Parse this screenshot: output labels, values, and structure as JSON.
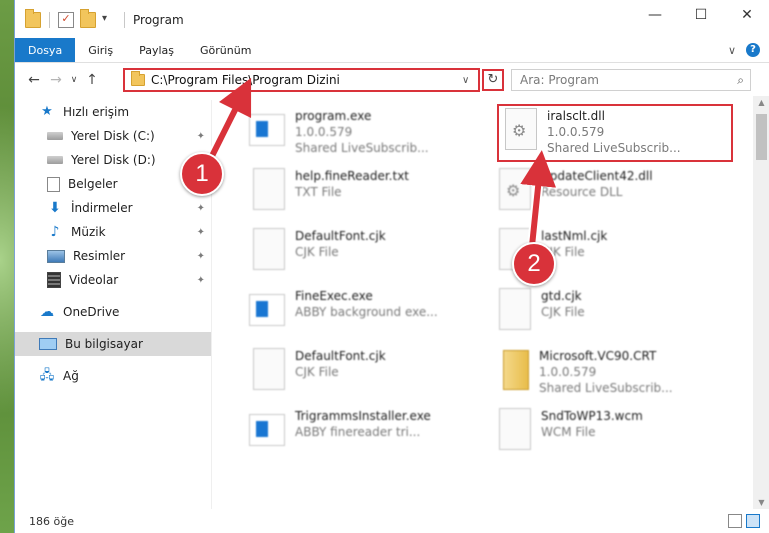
{
  "window": {
    "title": "Program",
    "controls": {
      "minimize": "—",
      "maximize": "☐",
      "close": "✕"
    }
  },
  "ribbon": {
    "tabs": [
      "Dosya",
      "Giriş",
      "Paylaş",
      "Görünüm"
    ],
    "active_tab": "Dosya",
    "collapse_glyph": "∨",
    "help_glyph": "?"
  },
  "address": {
    "path": "C:\\Program Files\\Program Dizini",
    "refresh_glyph": "↻",
    "dropdown_glyph": "∨"
  },
  "search": {
    "placeholder": "Ara: Program",
    "icon_glyph": "⌕"
  },
  "nav_buttons": {
    "back": "←",
    "forward": "→",
    "recent": "∨",
    "up": "↑"
  },
  "sidebar": {
    "items": [
      {
        "label": "Hızlı erişim",
        "icon": "star-icon",
        "pinned": false
      },
      {
        "label": "Yerel Disk (C:)",
        "icon": "disk-icon",
        "pinned": true
      },
      {
        "label": "Yerel Disk (D:)",
        "icon": "disk-icon",
        "pinned": false
      },
      {
        "label": "Belgeler",
        "icon": "documents-icon",
        "pinned": false
      },
      {
        "label": "İndirmeler",
        "icon": "downloads-icon",
        "pinned": true
      },
      {
        "label": "Müzik",
        "icon": "music-icon",
        "pinned": true
      },
      {
        "label": "Resimler",
        "icon": "pictures-icon",
        "pinned": true
      },
      {
        "label": "Videolar",
        "icon": "videos-icon",
        "pinned": true
      },
      {
        "label": "OneDrive",
        "icon": "onedrive-icon",
        "pinned": false
      },
      {
        "label": "Bu bilgisayar",
        "icon": "computer-icon",
        "pinned": false,
        "selected": true
      },
      {
        "label": "Ağ",
        "icon": "network-icon",
        "pinned": false
      }
    ],
    "pin_glyph": "📌"
  },
  "files": [
    {
      "name": "program.exe",
      "line2": "1.0.0.579",
      "line3": "Shared LiveSubscrib...",
      "icon": "exe-icon"
    },
    {
      "name": "iralsclt.dll",
      "line2": "1.0.0.579",
      "line3": "Shared LiveSubscrib...",
      "icon": "dll-icon"
    },
    {
      "name": "help.fineReader.txt",
      "line2": "TXT File",
      "line3": "",
      "icon": "document-icon"
    },
    {
      "name": "UpdateClient42.dll",
      "line2": "Resource DLL",
      "line3": "",
      "icon": "dll-icon"
    },
    {
      "name": "DefaultFont.cjk",
      "line2": "CJK File",
      "line3": "",
      "icon": "document-icon"
    },
    {
      "name": "lastNml.cjk",
      "line2": "CJK File",
      "line3": "",
      "icon": "document-icon"
    },
    {
      "name": "FineExec.exe",
      "line2": "ABBY background exe...",
      "line3": "",
      "icon": "exe-icon"
    },
    {
      "name": "gtd.cjk",
      "line2": "CJK File",
      "line3": "",
      "icon": "document-icon"
    },
    {
      "name": "DefaultFont.cjk",
      "line2": "CJK File",
      "line3": "",
      "icon": "document-icon"
    },
    {
      "name": "Microsoft.VC90.CRT",
      "line2": "1.0.0.579",
      "line3": "Shared LiveSubscrib...",
      "icon": "archive-icon"
    },
    {
      "name": "TrigrammsInstaller.exe",
      "line2": "ABBY finereader tri...",
      "line3": "",
      "icon": "exe-icon"
    },
    {
      "name": "SndToWP13.wcm",
      "line2": "WCM File",
      "line3": "",
      "icon": "document-icon"
    }
  ],
  "status": {
    "item_count": "186 öğe"
  },
  "annotations": [
    {
      "label": "1",
      "color": "#d9323a"
    },
    {
      "label": "2",
      "color": "#d9323a"
    }
  ],
  "colors": {
    "accent": "#1979ca",
    "highlight": "#d9323a"
  }
}
